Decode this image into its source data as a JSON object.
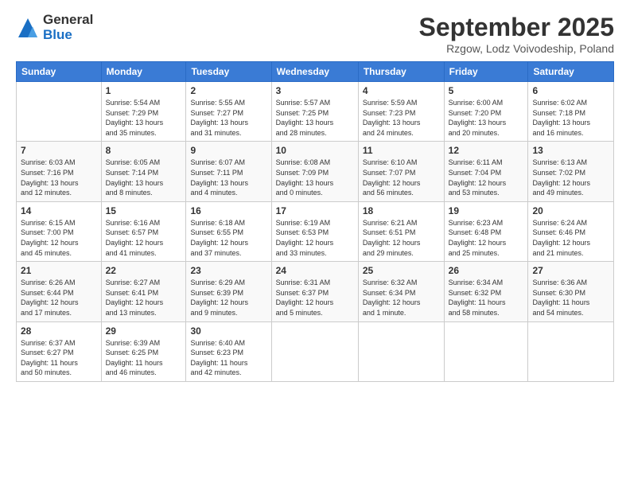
{
  "header": {
    "logo_line1": "General",
    "logo_line2": "Blue",
    "title": "September 2025",
    "location": "Rzgow, Lodz Voivodeship, Poland"
  },
  "days_of_week": [
    "Sunday",
    "Monday",
    "Tuesday",
    "Wednesday",
    "Thursday",
    "Friday",
    "Saturday"
  ],
  "weeks": [
    [
      {
        "day": "",
        "info": ""
      },
      {
        "day": "1",
        "info": "Sunrise: 5:54 AM\nSunset: 7:29 PM\nDaylight: 13 hours\nand 35 minutes."
      },
      {
        "day": "2",
        "info": "Sunrise: 5:55 AM\nSunset: 7:27 PM\nDaylight: 13 hours\nand 31 minutes."
      },
      {
        "day": "3",
        "info": "Sunrise: 5:57 AM\nSunset: 7:25 PM\nDaylight: 13 hours\nand 28 minutes."
      },
      {
        "day": "4",
        "info": "Sunrise: 5:59 AM\nSunset: 7:23 PM\nDaylight: 13 hours\nand 24 minutes."
      },
      {
        "day": "5",
        "info": "Sunrise: 6:00 AM\nSunset: 7:20 PM\nDaylight: 13 hours\nand 20 minutes."
      },
      {
        "day": "6",
        "info": "Sunrise: 6:02 AM\nSunset: 7:18 PM\nDaylight: 13 hours\nand 16 minutes."
      }
    ],
    [
      {
        "day": "7",
        "info": "Sunrise: 6:03 AM\nSunset: 7:16 PM\nDaylight: 13 hours\nand 12 minutes."
      },
      {
        "day": "8",
        "info": "Sunrise: 6:05 AM\nSunset: 7:14 PM\nDaylight: 13 hours\nand 8 minutes."
      },
      {
        "day": "9",
        "info": "Sunrise: 6:07 AM\nSunset: 7:11 PM\nDaylight: 13 hours\nand 4 minutes."
      },
      {
        "day": "10",
        "info": "Sunrise: 6:08 AM\nSunset: 7:09 PM\nDaylight: 13 hours\nand 0 minutes."
      },
      {
        "day": "11",
        "info": "Sunrise: 6:10 AM\nSunset: 7:07 PM\nDaylight: 12 hours\nand 56 minutes."
      },
      {
        "day": "12",
        "info": "Sunrise: 6:11 AM\nSunset: 7:04 PM\nDaylight: 12 hours\nand 53 minutes."
      },
      {
        "day": "13",
        "info": "Sunrise: 6:13 AM\nSunset: 7:02 PM\nDaylight: 12 hours\nand 49 minutes."
      }
    ],
    [
      {
        "day": "14",
        "info": "Sunrise: 6:15 AM\nSunset: 7:00 PM\nDaylight: 12 hours\nand 45 minutes."
      },
      {
        "day": "15",
        "info": "Sunrise: 6:16 AM\nSunset: 6:57 PM\nDaylight: 12 hours\nand 41 minutes."
      },
      {
        "day": "16",
        "info": "Sunrise: 6:18 AM\nSunset: 6:55 PM\nDaylight: 12 hours\nand 37 minutes."
      },
      {
        "day": "17",
        "info": "Sunrise: 6:19 AM\nSunset: 6:53 PM\nDaylight: 12 hours\nand 33 minutes."
      },
      {
        "day": "18",
        "info": "Sunrise: 6:21 AM\nSunset: 6:51 PM\nDaylight: 12 hours\nand 29 minutes."
      },
      {
        "day": "19",
        "info": "Sunrise: 6:23 AM\nSunset: 6:48 PM\nDaylight: 12 hours\nand 25 minutes."
      },
      {
        "day": "20",
        "info": "Sunrise: 6:24 AM\nSunset: 6:46 PM\nDaylight: 12 hours\nand 21 minutes."
      }
    ],
    [
      {
        "day": "21",
        "info": "Sunrise: 6:26 AM\nSunset: 6:44 PM\nDaylight: 12 hours\nand 17 minutes."
      },
      {
        "day": "22",
        "info": "Sunrise: 6:27 AM\nSunset: 6:41 PM\nDaylight: 12 hours\nand 13 minutes."
      },
      {
        "day": "23",
        "info": "Sunrise: 6:29 AM\nSunset: 6:39 PM\nDaylight: 12 hours\nand 9 minutes."
      },
      {
        "day": "24",
        "info": "Sunrise: 6:31 AM\nSunset: 6:37 PM\nDaylight: 12 hours\nand 5 minutes."
      },
      {
        "day": "25",
        "info": "Sunrise: 6:32 AM\nSunset: 6:34 PM\nDaylight: 12 hours\nand 1 minute."
      },
      {
        "day": "26",
        "info": "Sunrise: 6:34 AM\nSunset: 6:32 PM\nDaylight: 11 hours\nand 58 minutes."
      },
      {
        "day": "27",
        "info": "Sunrise: 6:36 AM\nSunset: 6:30 PM\nDaylight: 11 hours\nand 54 minutes."
      }
    ],
    [
      {
        "day": "28",
        "info": "Sunrise: 6:37 AM\nSunset: 6:27 PM\nDaylight: 11 hours\nand 50 minutes."
      },
      {
        "day": "29",
        "info": "Sunrise: 6:39 AM\nSunset: 6:25 PM\nDaylight: 11 hours\nand 46 minutes."
      },
      {
        "day": "30",
        "info": "Sunrise: 6:40 AM\nSunset: 6:23 PM\nDaylight: 11 hours\nand 42 minutes."
      },
      {
        "day": "",
        "info": ""
      },
      {
        "day": "",
        "info": ""
      },
      {
        "day": "",
        "info": ""
      },
      {
        "day": "",
        "info": ""
      }
    ]
  ]
}
